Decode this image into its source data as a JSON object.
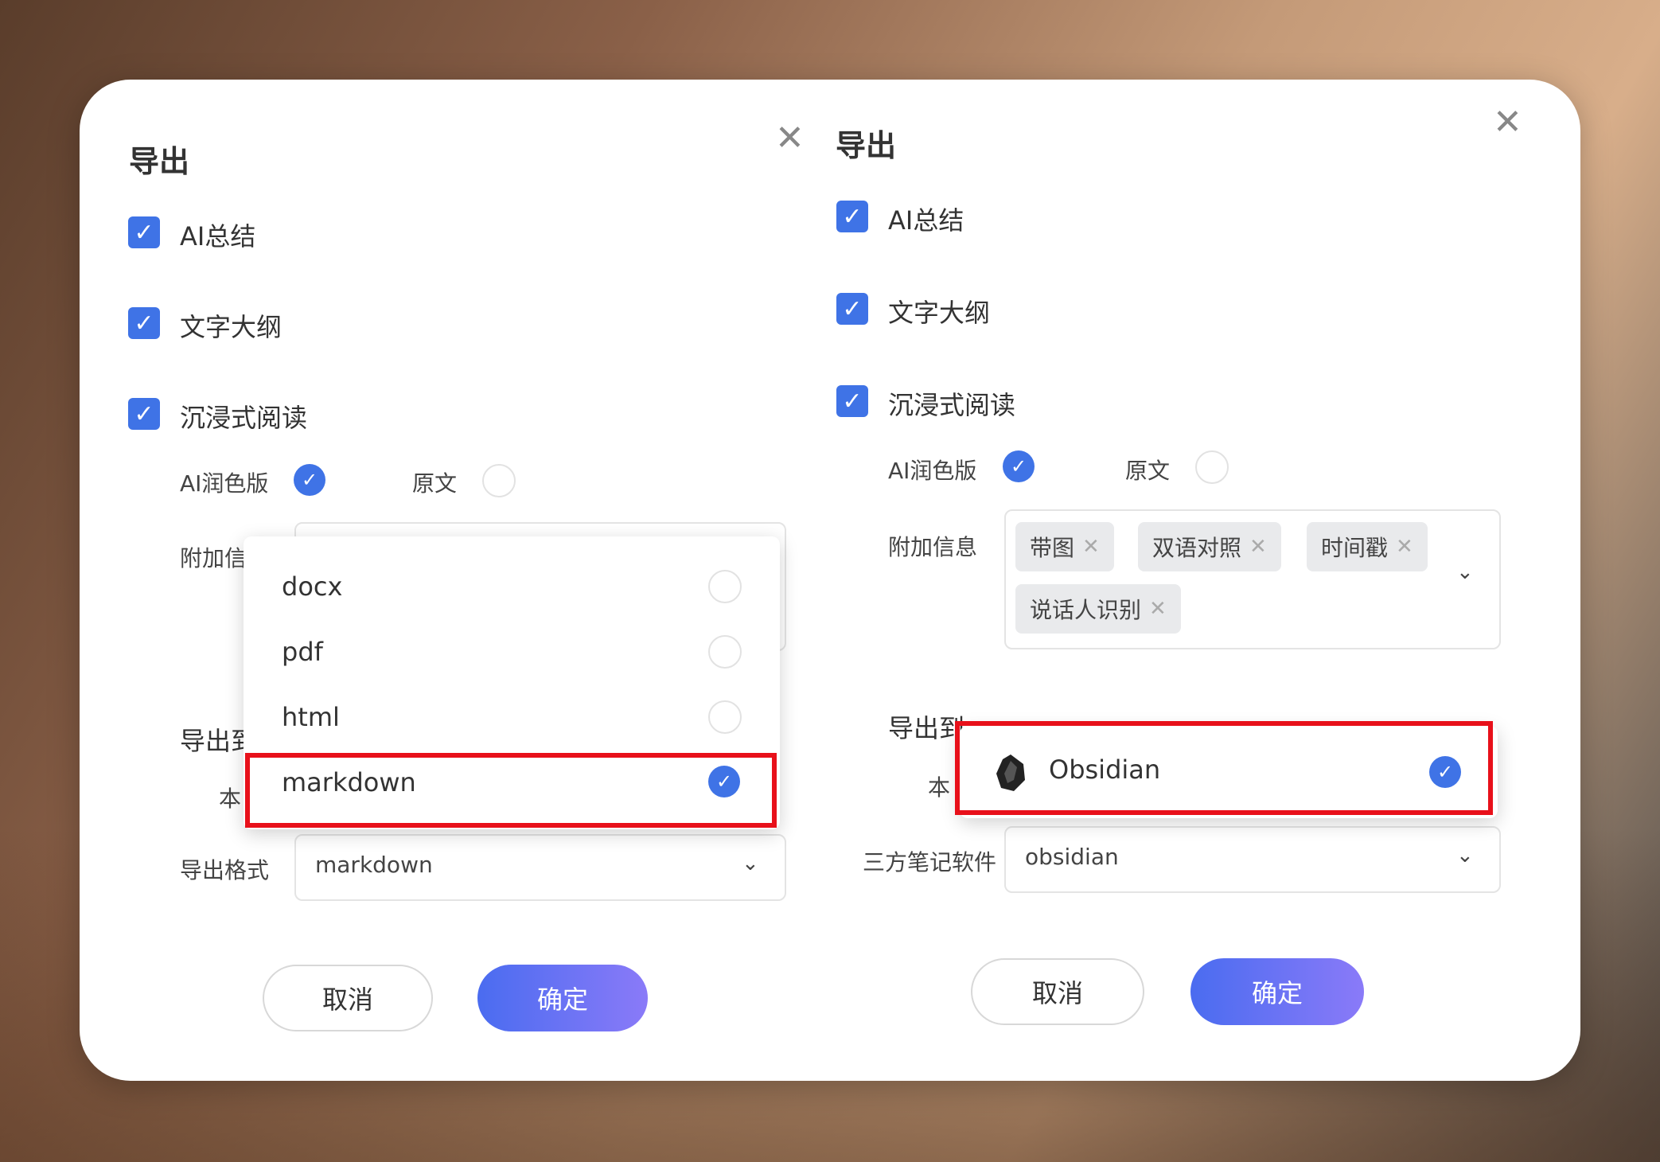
{
  "left": {
    "title": "导出",
    "checks": [
      "AI总结",
      "文字大纲",
      "沉浸式阅读"
    ],
    "version": {
      "polished": "AI润色版",
      "original": "原文"
    },
    "extra_label_partial": "附加信",
    "export_to_partial": "导出到",
    "local_partial": "本",
    "format_label": "导出格式",
    "format_value": "markdown",
    "options": [
      "docx",
      "pdf",
      "html",
      "markdown"
    ],
    "selected_option": "markdown",
    "cancel": "取消",
    "confirm": "确定"
  },
  "right": {
    "title": "导出",
    "checks": [
      "AI总结",
      "文字大纲",
      "沉浸式阅读"
    ],
    "version": {
      "polished": "AI润色版",
      "original": "原文"
    },
    "extra_label": "附加信息",
    "tags": [
      "带图",
      "双语对照",
      "时间戳",
      "说话人识别"
    ],
    "export_to_partial": "导出到",
    "local_partial": "本",
    "option_obsidian": "Obsidian",
    "notes_label": "三方笔记软件",
    "notes_value": "obsidian",
    "cancel": "取消",
    "confirm": "确定"
  },
  "icons": {
    "close": "close-icon",
    "check": "check-icon",
    "chevron": "chevron-down-icon",
    "obsidian": "obsidian-icon",
    "tag_remove": "tag-close-icon"
  },
  "colors": {
    "accent": "#3f73e6",
    "highlight": "#e8101a",
    "button_gradient_start": "#4a6cf0",
    "button_gradient_end": "#8a7af8"
  }
}
